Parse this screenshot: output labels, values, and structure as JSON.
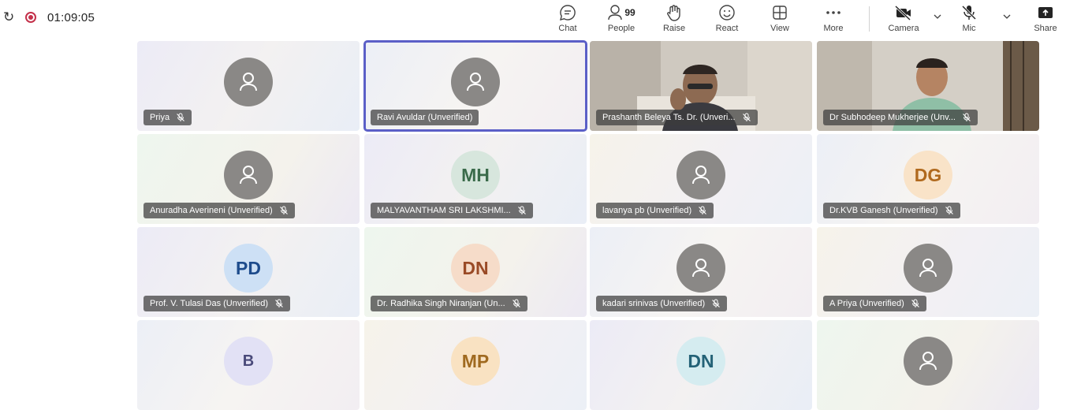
{
  "recording": {
    "timer": "01:09:05"
  },
  "toolbar": {
    "chat": "Chat",
    "people": "People",
    "people_count": "99",
    "raise": "Raise",
    "react": "React",
    "view": "View",
    "more": "More",
    "camera": "Camera",
    "mic": "Mic",
    "share": "Share"
  },
  "participants": [
    {
      "name": "Priya",
      "avatar": "person-icon",
      "muted": true
    },
    {
      "name": "Ravi Avuldar (Unverified)",
      "avatar": "person-icon",
      "muted": false,
      "active": true
    },
    {
      "name": "Prashanth Beleya Ts. Dr. (Unveri...",
      "avatar": "video",
      "muted": true
    },
    {
      "name": "Dr Subhodeep Mukherjee (Unv...",
      "avatar": "video",
      "muted": true
    },
    {
      "name": "Anuradha Averineni (Unverified)",
      "avatar": "person-icon",
      "muted": true
    },
    {
      "name": "MALYAVANTHAM SRI LAKSHMI...",
      "initials": "MH",
      "muted": true
    },
    {
      "name": "lavanya pb (Unverified)",
      "avatar": "person-icon",
      "muted": true
    },
    {
      "name": "Dr.KVB Ganesh (Unverified)",
      "initials": "DG",
      "muted": true
    },
    {
      "name": "Prof. V. Tulasi Das (Unverified)",
      "initials": "PD",
      "muted": true
    },
    {
      "name": "Dr. Radhika Singh Niranjan (Un...",
      "initials": "DN",
      "muted": true
    },
    {
      "name": "kadari srinivas (Unverified)",
      "avatar": "person-icon",
      "muted": true
    },
    {
      "name": "A Priya (Unverified)",
      "avatar": "person-icon",
      "muted": true
    },
    {
      "initials": "B"
    },
    {
      "initials": "MP"
    },
    {
      "initials": "DN"
    },
    {
      "avatar": "person-icon"
    }
  ],
  "colors": {
    "accent": "#5b5fc7",
    "recording": "#c4314b",
    "avatar_generic": "#8a8886",
    "MH_bg": "#d7e6dd",
    "MH_fg": "#3a6b4a",
    "DG_bg": "#f9e3c8",
    "DG_fg": "#b0691d",
    "PD_bg": "#cde0f5",
    "PD_fg": "#1d4b8c",
    "DN_bg": "#f6dcc9",
    "DN_fg": "#9a4a26",
    "B_bg": "#e2e1f5",
    "B_fg": "#4a4a7a",
    "MP_bg": "#f9e2c2",
    "MP_fg": "#a06a20",
    "DN2_bg": "#d5ecf0",
    "DN2_fg": "#246277"
  }
}
